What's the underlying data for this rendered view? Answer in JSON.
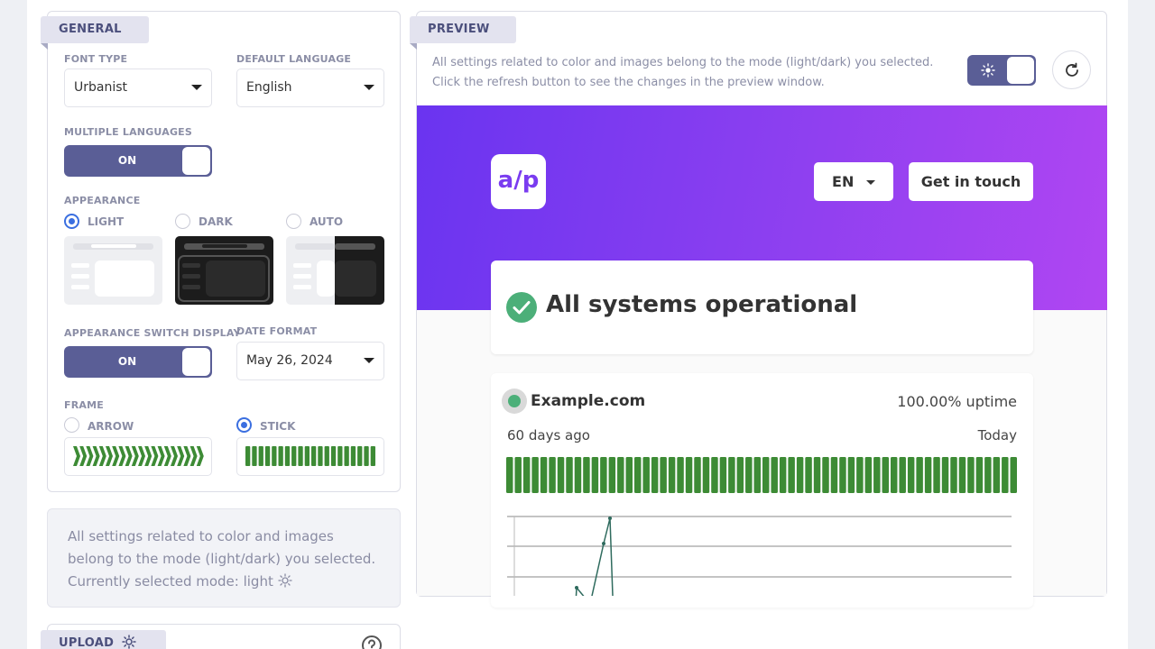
{
  "general": {
    "tab_label": "GENERAL",
    "font_type": {
      "label": "FONT TYPE",
      "value": "Urbanist"
    },
    "default_language": {
      "label": "DEFAULT LANGUAGE",
      "value": "English"
    },
    "multiple_languages": {
      "label": "MULTIPLE LANGUAGES",
      "toggle": "ON"
    },
    "appearance": {
      "label": "APPEARANCE",
      "options": [
        {
          "label": "LIGHT",
          "selected": true
        },
        {
          "label": "DARK",
          "selected": false
        },
        {
          "label": "AUTO",
          "selected": false
        }
      ]
    },
    "appearance_switch": {
      "label": "APPEARANCE SWITCH DISPLAY",
      "toggle": "ON"
    },
    "date_format": {
      "label": "DATE FORMAT",
      "value": "May 26, 2024"
    },
    "frame": {
      "label": "FRAME",
      "options": [
        {
          "label": "ARROW",
          "selected": false
        },
        {
          "label": "STICK",
          "selected": true
        }
      ]
    }
  },
  "info_note": "All settings related to color and images belong to the mode (light/dark) you selected. Currently selected mode: light",
  "upload": {
    "tab_label": "UPLOAD"
  },
  "preview": {
    "tab_label": "PREVIEW",
    "line1": "All settings related to color and images belong to the mode (light/dark) you selected.",
    "line2": "Click the refresh button to see the changes in the preview window.",
    "logo_text": "a/p",
    "lang_button": "EN",
    "contact_button": "Get in touch",
    "status_text": "All systems operational",
    "monitor": {
      "name": "Example.com",
      "uptime": "100.00% uptime",
      "range_start": "60 days ago",
      "range_end": "Today"
    }
  },
  "colors": {
    "accent": "#5a5e96",
    "bar": "#3d8b35",
    "status": "#4caf79",
    "banner_start": "#6a34f0",
    "banner_end": "#b046f2"
  }
}
